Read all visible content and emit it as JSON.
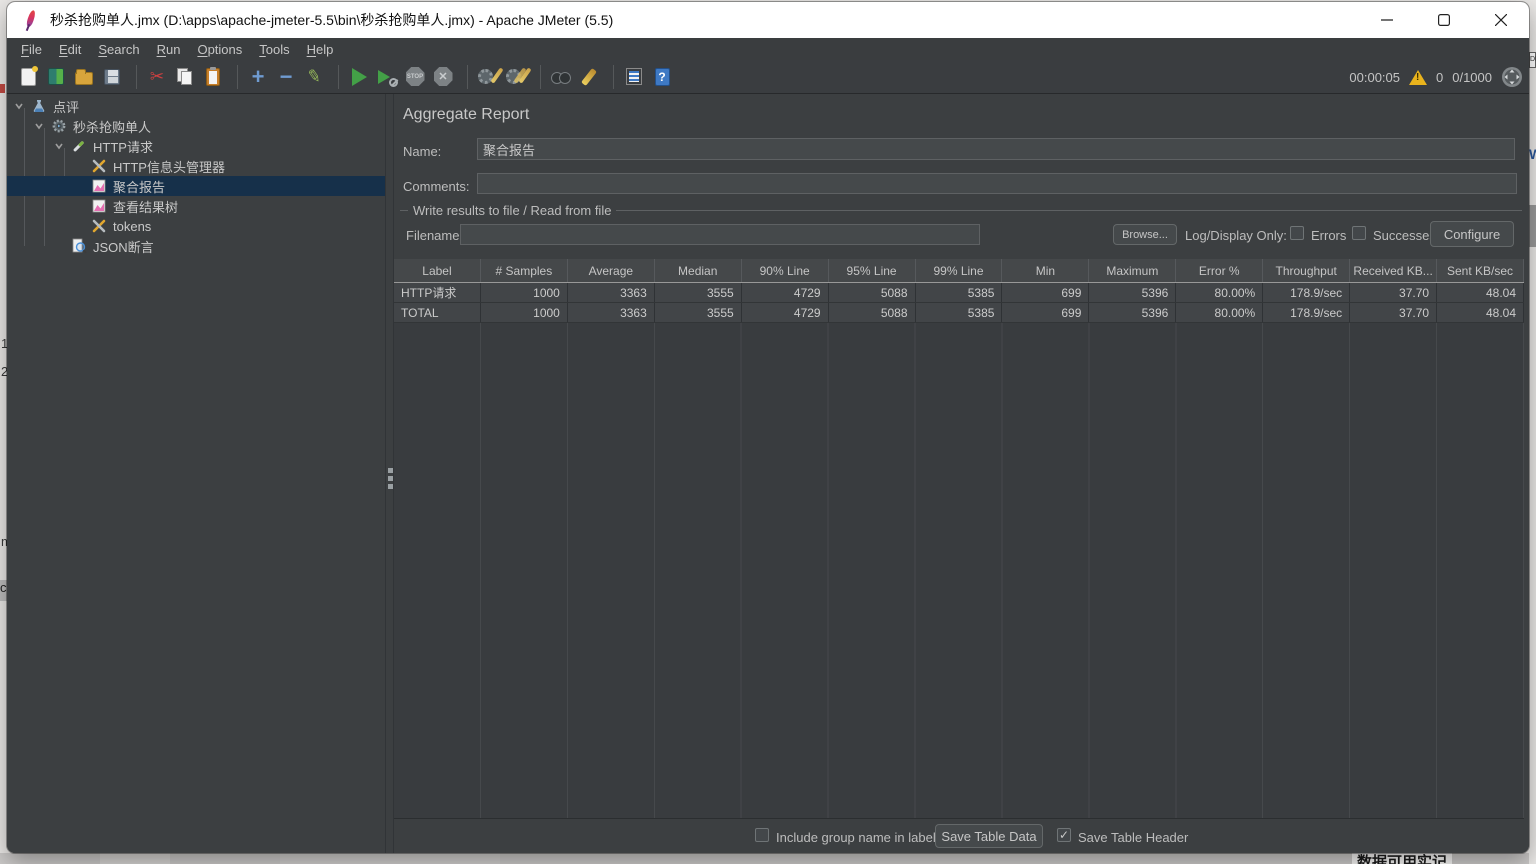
{
  "window": {
    "title": "秒杀抢购单人.jmx (D:\\apps\\apache-jmeter-5.5\\bin\\秒杀抢购单人.jmx) - Apache JMeter (5.5)",
    "controls": {
      "minimize": "minimize",
      "maximize": "maximize",
      "close": "close"
    }
  },
  "menu": {
    "items": [
      "File",
      "Edit",
      "Search",
      "Run",
      "Options",
      "Tools",
      "Help"
    ]
  },
  "toolbar": {
    "icons": [
      "new-file",
      "templates",
      "open-file",
      "save",
      "cut",
      "copy",
      "paste",
      "add-element",
      "remove-element",
      "edit",
      "start",
      "start-no-timers",
      "stop",
      "shutdown",
      "clear",
      "clear-all",
      "search",
      "clear-search",
      "function-helper",
      "help"
    ],
    "elapsed": "00:00:05",
    "warning_count": "0",
    "threads": "0/1000"
  },
  "tree": {
    "items": [
      {
        "label": "点评",
        "icon": "test-plan",
        "depth": 0,
        "expanded": true,
        "selected": false
      },
      {
        "label": "秒杀抢购单人",
        "icon": "thread-group",
        "depth": 1,
        "expanded": true,
        "selected": false
      },
      {
        "label": "HTTP请求",
        "icon": "http-sampler",
        "depth": 2,
        "expanded": true,
        "selected": false
      },
      {
        "label": "HTTP信息头管理器",
        "icon": "header-manager",
        "depth": 3,
        "expanded": false,
        "selected": false
      },
      {
        "label": "聚合报告",
        "icon": "listener-chart",
        "depth": 3,
        "expanded": false,
        "selected": true
      },
      {
        "label": "查看结果树",
        "icon": "listener-chart",
        "depth": 3,
        "expanded": false,
        "selected": false
      },
      {
        "label": "tokens",
        "icon": "header-manager",
        "depth": 3,
        "expanded": false,
        "selected": false
      },
      {
        "label": "JSON断言",
        "icon": "json-assertion",
        "depth": 2,
        "expanded": false,
        "selected": false
      }
    ]
  },
  "panel": {
    "title": "Aggregate Report",
    "name_label": "Name:",
    "name_value": "聚合报告",
    "comments_label": "Comments:",
    "comments_value": "",
    "file_group": {
      "title": "Write results to file / Read from file",
      "filename_label": "Filename",
      "filename_value": "",
      "browse_label": "Browse...",
      "log_display_label": "Log/Display Only:",
      "errors_label": "Errors",
      "errors_checked": false,
      "successes_label": "Successes",
      "successes_checked": false,
      "configure_label": "Configure"
    },
    "footer": {
      "include_group_label": "Include group name in label?",
      "include_group_checked": false,
      "save_data_label": "Save Table Data",
      "save_header_label": "Save Table Header",
      "save_header_checked": true
    }
  },
  "table": {
    "columns": [
      "Label",
      "# Samples",
      "Average",
      "Median",
      "90% Line",
      "95% Line",
      "99% Line",
      "Min",
      "Maximum",
      "Error %",
      "Throughput",
      "Received KB...",
      "Sent KB/sec"
    ],
    "rows": [
      [
        "HTTP请求",
        "1000",
        "3363",
        "3555",
        "4729",
        "5088",
        "5385",
        "699",
        "5396",
        "80.00%",
        "178.9/sec",
        "37.70",
        "48.04"
      ],
      [
        "TOTAL",
        "1000",
        "3363",
        "3555",
        "4729",
        "5088",
        "5385",
        "699",
        "5396",
        "80.00%",
        "178.9/sec",
        "37.70",
        "48.04"
      ]
    ]
  },
  "background": {
    "bottom_right_text": "数据可用实记",
    "right_edge_box_text": "DD",
    "left_edge_marks": [
      "1",
      "2",
      "m",
      "c"
    ]
  },
  "colors": {
    "selection": "#16304a",
    "warning": "#e9b31c",
    "panel_bg": "#3c3f41",
    "titlebar_bg": "#ffffff"
  }
}
